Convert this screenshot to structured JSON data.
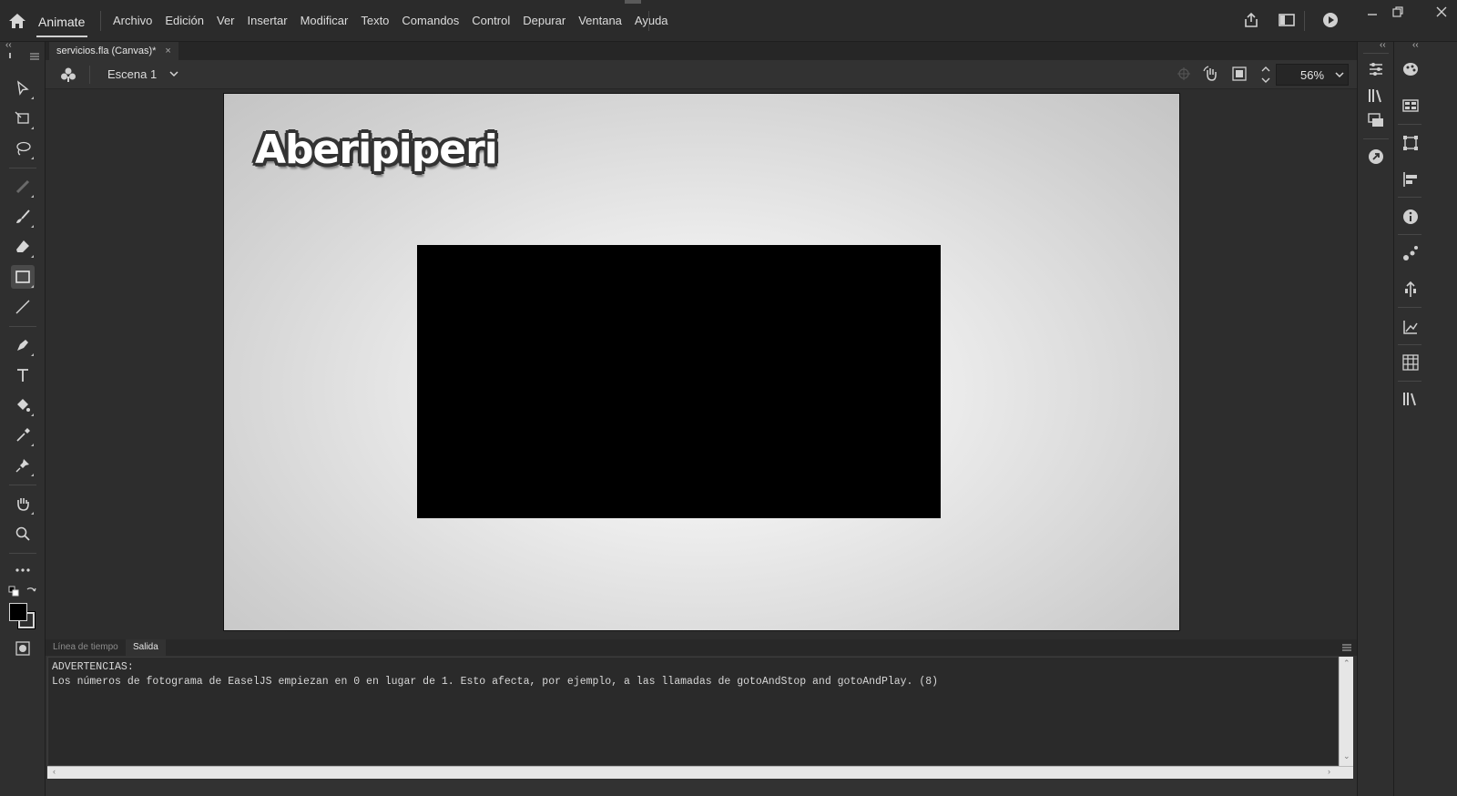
{
  "app": {
    "name": "Animate"
  },
  "menu": [
    "Archivo",
    "Edición",
    "Ver",
    "Insertar",
    "Modificar",
    "Texto",
    "Comandos",
    "Control",
    "Depurar",
    "Ventana",
    "Ayuda"
  ],
  "document": {
    "tab_title": "servicios.fla (Canvas)*",
    "close_glyph": "×"
  },
  "scene": {
    "name": "Escena 1"
  },
  "zoom": {
    "value": "56%"
  },
  "stage": {
    "logo_text": "Aberipiperi",
    "box_color": "#000000"
  },
  "panel": {
    "tabs": [
      {
        "label": "Línea de tiempo"
      },
      {
        "label": "Salida"
      }
    ],
    "active_tab": "Salida",
    "output_lines": [
      "ADVERTENCIAS:",
      "Los números de fotograma de EaselJS empiezan en 0 en lugar de 1. Esto afecta, por ejemplo, a las llamadas de gotoAndStop and gotoAndPlay. (8)"
    ]
  },
  "icons": {
    "home": "home-icon",
    "share": "share-icon",
    "workspace": "workspace-icon",
    "play": "test-movie-icon",
    "tools": [
      "selection-tool-icon",
      "free-transform-tool-icon",
      "lasso-tool-icon",
      "bone-tool-icon",
      "brush-tool-icon",
      "eraser-tool-icon",
      "rectangle-tool-icon",
      "line-tool-icon",
      "pen-tool-icon",
      "text-tool-icon",
      "paint-bucket-tool-icon",
      "eyedropper-tool-icon",
      "pin-tool-icon",
      "hand-tool-icon",
      "zoom-tool-icon",
      "more-tools-icon"
    ]
  },
  "colors": {
    "accent": "#d0d0d0",
    "stroke": "#000000",
    "fill": "#000000"
  }
}
